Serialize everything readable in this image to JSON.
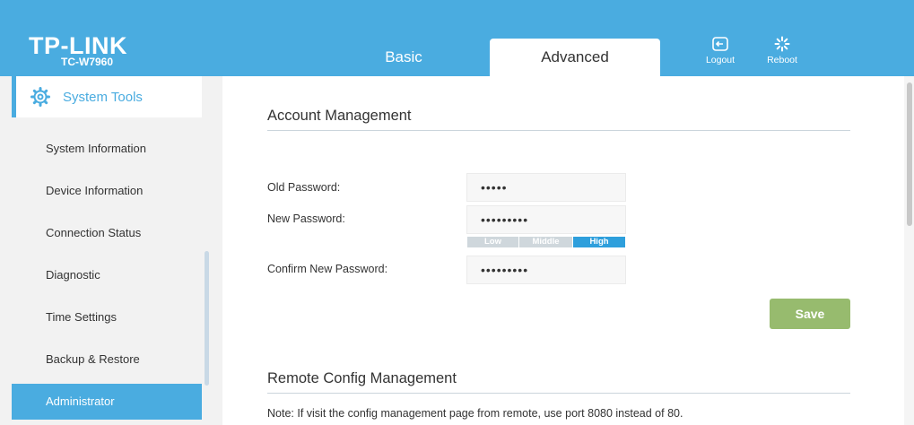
{
  "brand": {
    "logo": "TP-LINK",
    "model": "TC-W7960"
  },
  "tabs": [
    {
      "label": "Basic",
      "active": false
    },
    {
      "label": "Advanced",
      "active": true
    }
  ],
  "header_buttons": {
    "logout": {
      "label": "Logout",
      "icon": "logout-icon"
    },
    "reboot": {
      "label": "Reboot",
      "icon": "reboot-icon"
    }
  },
  "sidebar": {
    "section": {
      "label": "System Tools",
      "icon": "gear-icon"
    },
    "items": [
      {
        "label": "System Information"
      },
      {
        "label": "Device Information"
      },
      {
        "label": "Connection Status"
      },
      {
        "label": "Diagnostic"
      },
      {
        "label": "Time Settings"
      },
      {
        "label": "Backup & Restore"
      },
      {
        "label": "Administrator",
        "active": true
      }
    ]
  },
  "account": {
    "title": "Account Management",
    "old_password_label": "Old Password:",
    "old_password_value": "•••••",
    "new_password_label": "New Password:",
    "new_password_value": "•••••••••",
    "confirm_password_label": "Confirm New Password:",
    "confirm_password_value": "•••••••••",
    "strength": {
      "low": "Low",
      "middle": "Middle",
      "high": "High",
      "level": "High"
    },
    "save_label": "Save"
  },
  "remote": {
    "title": "Remote Config Management",
    "note": "Note: If visit the config management page from remote, use port 8080 instead of 80."
  },
  "colors": {
    "header": "#4aace0",
    "active_item": "#4aace0",
    "save_button": "#97bb6e",
    "strength_high": "#2e9fdc"
  }
}
